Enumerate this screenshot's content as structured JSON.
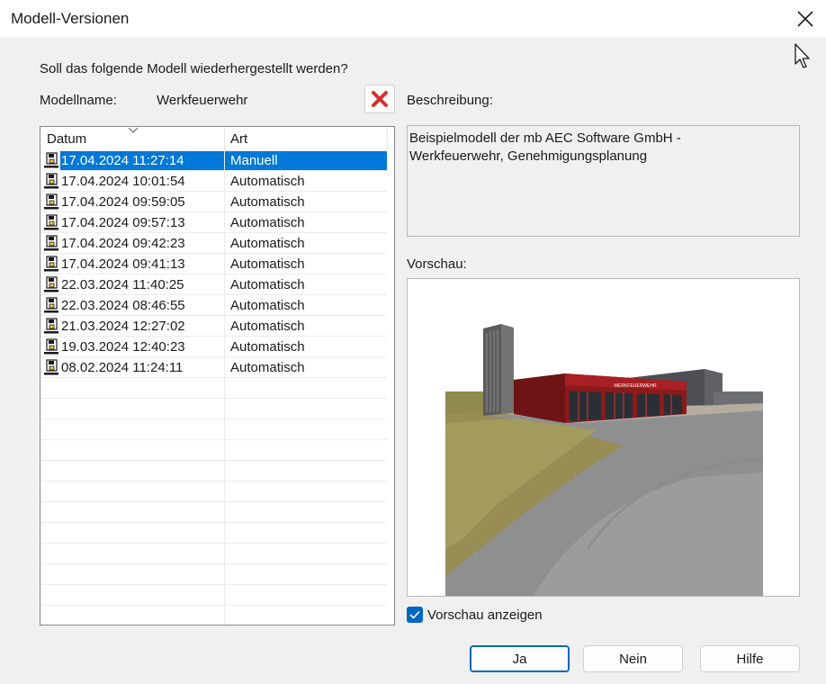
{
  "window": {
    "title": "Modell-Versionen"
  },
  "question": "Soll das folgende Modell wiederhergestellt werden?",
  "model": {
    "label": "Modellname:",
    "value": "Werkfeuerwehr"
  },
  "list": {
    "columns": {
      "datum": "Datum",
      "art": "Art"
    },
    "rows": [
      {
        "date": "17.04.2024 11:27:14",
        "art": "Manuell",
        "selected": true
      },
      {
        "date": "17.04.2024 10:01:54",
        "art": "Automatisch"
      },
      {
        "date": "17.04.2024 09:59:05",
        "art": "Automatisch"
      },
      {
        "date": "17.04.2024 09:57:13",
        "art": "Automatisch"
      },
      {
        "date": "17.04.2024 09:42:23",
        "art": "Automatisch"
      },
      {
        "date": "17.04.2024 09:41:13",
        "art": "Automatisch"
      },
      {
        "date": "22.03.2024 11:40:25",
        "art": "Automatisch"
      },
      {
        "date": "22.03.2024 08:46:55",
        "art": "Automatisch"
      },
      {
        "date": "21.03.2024 12:27:02",
        "art": "Automatisch"
      },
      {
        "date": "19.03.2024 12:40:23",
        "art": "Automatisch"
      },
      {
        "date": "08.02.2024 11:24:11",
        "art": "Automatisch"
      }
    ],
    "empty_rows": 12
  },
  "description": {
    "label": "Beschreibung:",
    "text": "Beispielmodell der mb AEC Software GmbH -\nWerkfeuerwehr, Genehmigungsplanung"
  },
  "preview": {
    "label": "Vorschau:",
    "sign_text": "WERKFEUERWEHR"
  },
  "checkbox": {
    "label": "Vorschau anzeigen",
    "checked": true
  },
  "buttons": {
    "yes": "Ja",
    "no": "Nein",
    "help": "Hilfe"
  },
  "icons": {
    "close": "close-icon",
    "delete": "delete-x-icon",
    "row": "floppy-disk-icon",
    "sort": "sort-chevron-down-icon",
    "cursor": "mouse-pointer-icon"
  },
  "colors": {
    "selection": "#0078d7",
    "accent": "#0067c0",
    "delete_red": "#d32f2f"
  }
}
